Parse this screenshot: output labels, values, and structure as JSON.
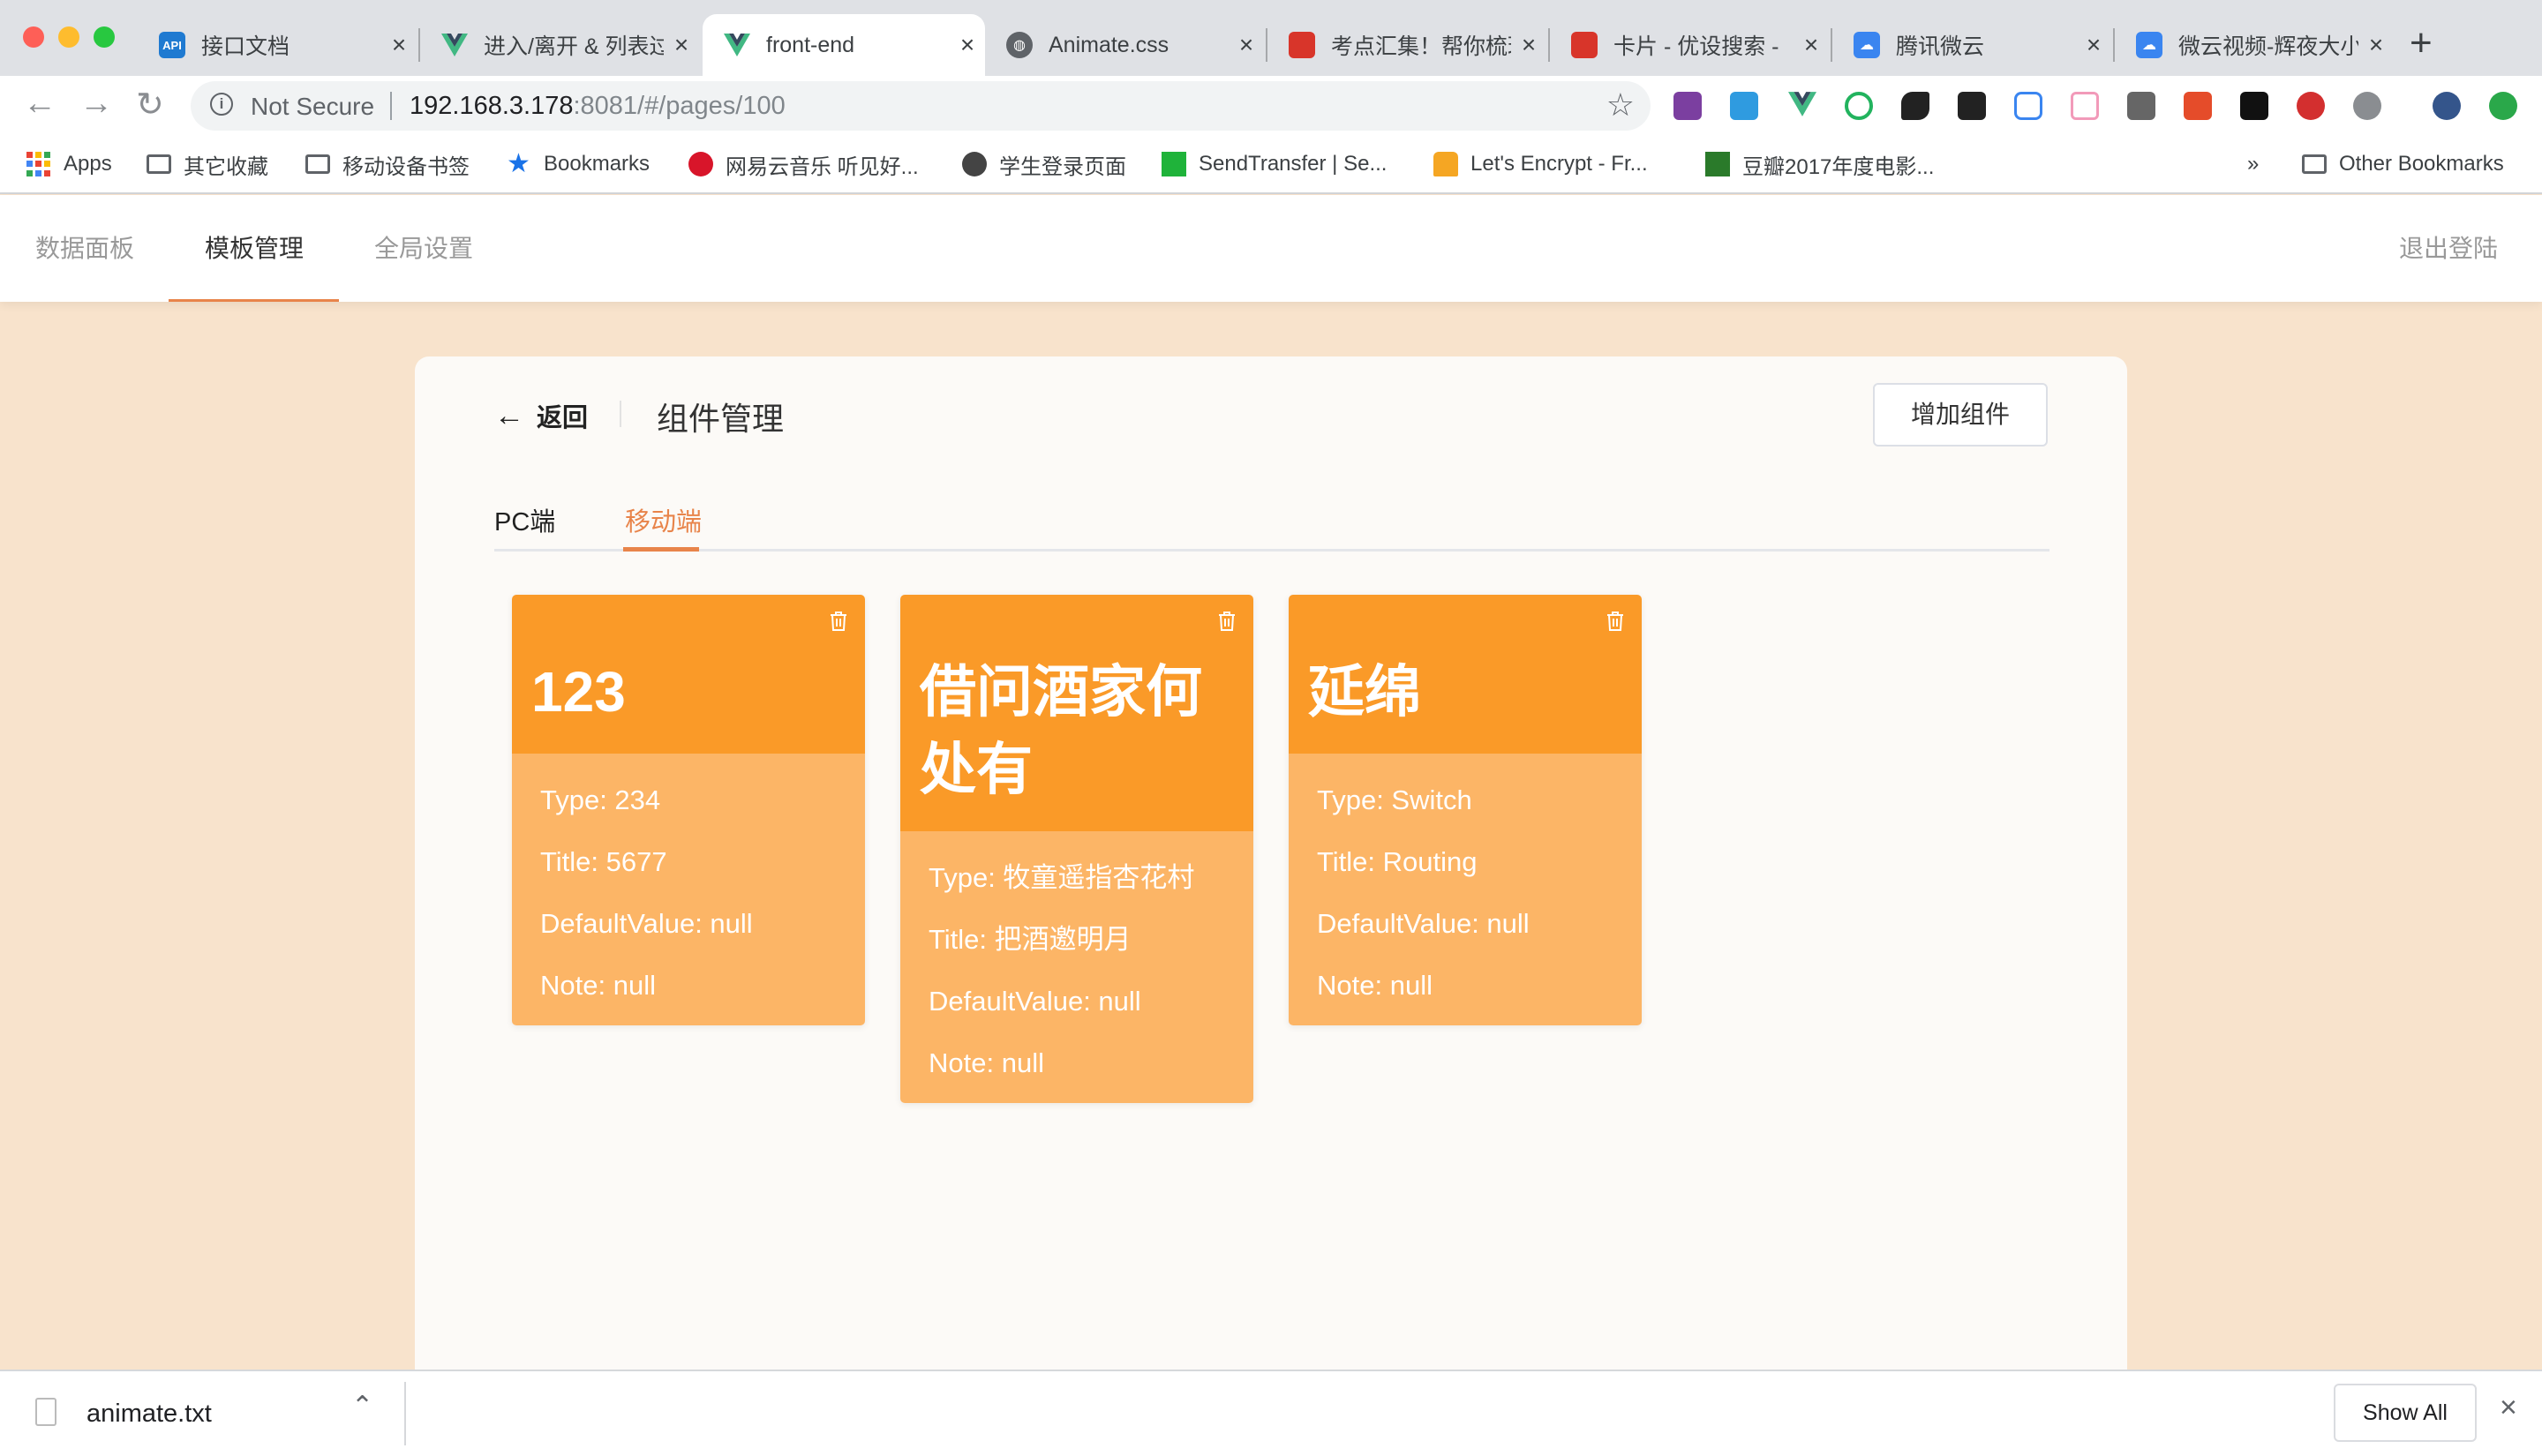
{
  "browser": {
    "tabs": [
      {
        "title": "接口文档",
        "icon": "api-icon",
        "color": "#1f7ad1"
      },
      {
        "title": "进入/离开 & 列表过渡",
        "icon": "vue-icon",
        "color": "#41b883"
      },
      {
        "title": "front-end",
        "icon": "vue-icon",
        "color": "#41b883",
        "active": true
      },
      {
        "title": "Animate.css",
        "icon": "globe-icon",
        "color": "#5f6368"
      },
      {
        "title": "考点汇集！帮你梳理",
        "icon": "site-icon",
        "color": "#d8352a"
      },
      {
        "title": "卡片 - 优设搜索 - ",
        "icon": "site-icon",
        "color": "#d8352a"
      },
      {
        "title": "腾讯微云",
        "icon": "weiyun-icon",
        "color": "#3a85f0"
      },
      {
        "title": "微云视频-辉夜大小姐",
        "icon": "weiyun-icon",
        "color": "#3a85f0"
      }
    ],
    "security_label": "Not Secure",
    "url_host": "192.168.3.178",
    "url_rest": ":8081/#/pages/100",
    "bookmarks": [
      {
        "label": "Apps",
        "icon": "apps-grid-icon"
      },
      {
        "label": "其它收藏",
        "icon": "folder-icon"
      },
      {
        "label": "移动设备书签",
        "icon": "folder-icon"
      },
      {
        "label": "Bookmarks",
        "icon": "star-icon"
      },
      {
        "label": "网易云音乐 听见好...",
        "icon": "netease-music-icon"
      },
      {
        "label": "学生登录页面",
        "icon": "globe-icon"
      },
      {
        "label": "SendTransfer | Se...",
        "icon": "green-square-icon"
      },
      {
        "label": "Let's Encrypt - Fr...",
        "icon": "letsencrypt-icon"
      },
      {
        "label": "豆瓣2017年度电影...",
        "icon": "douban-icon"
      }
    ],
    "bookmarks_overflow": "»",
    "other_bookmarks": "Other Bookmarks"
  },
  "app": {
    "nav": [
      "数据面板",
      "模板管理",
      "全局设置"
    ],
    "logout": "退出登陆",
    "back_label": "返回",
    "page_title": "组件管理",
    "add_button": "增加组件",
    "platform_tabs": [
      "PC端",
      "移动端"
    ],
    "cards": [
      {
        "title": "123",
        "type": "Type: 234",
        "title_field": "Title: 5677",
        "default_value": "DefaultValue: null",
        "note": "Note: null"
      },
      {
        "title": "借问酒家何处有",
        "type": "Type: 牧童遥指杏花村",
        "title_field": "Title: 把酒邀明月",
        "default_value": "DefaultValue: null",
        "note": "Note: null"
      },
      {
        "title": "延绵",
        "type": "Type: Switch",
        "title_field": "Title: Routing",
        "default_value": "DefaultValue: null",
        "note": "Note: null"
      }
    ]
  },
  "downloads": {
    "file_name": "animate.txt",
    "show_all": "Show All"
  },
  "colors": {
    "accent": "#e8844a",
    "card_header": "#fa9a28",
    "card_body": "#fcb566",
    "page_background": "#f8e3cc"
  }
}
